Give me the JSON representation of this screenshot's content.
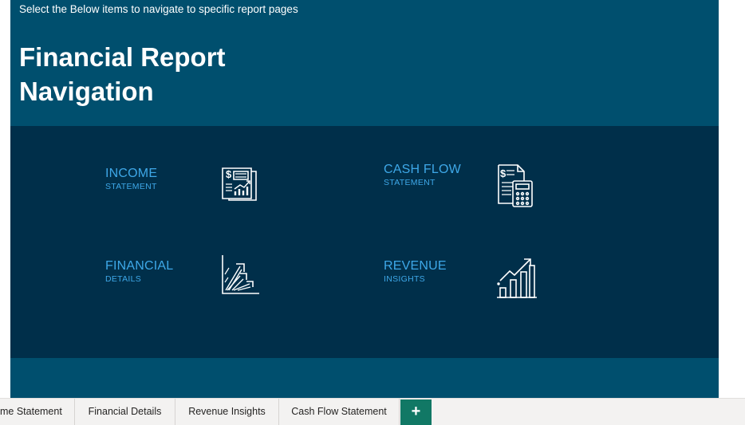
{
  "header": {
    "instruction": "Select the Below items to navigate to specific report pages",
    "title": "Financial Report Navigation"
  },
  "nav_items": [
    {
      "title": "INCOME",
      "subtitle": "STATEMENT",
      "icon": "income-statement-icon"
    },
    {
      "title": "CASH FLOW",
      "subtitle": "STATEMENT",
      "icon": "calculator-document-icon"
    },
    {
      "title": "FINANCIAL",
      "subtitle": "DETAILS",
      "icon": "rising-arrows-icon"
    },
    {
      "title": "REVENUE",
      "subtitle": "INSIGHTS",
      "icon": "growth-chart-icon"
    }
  ],
  "tabs": [
    {
      "label": "me Statement"
    },
    {
      "label": "Financial Details"
    },
    {
      "label": "Revenue Insights"
    },
    {
      "label": "Cash Flow Statement"
    }
  ],
  "add_tab_label": "+",
  "colors": {
    "header_bg": "#004f6e",
    "panel_bg": "#002f4a",
    "link_text": "#3ea8e8",
    "add_tab_bg": "#117865"
  }
}
